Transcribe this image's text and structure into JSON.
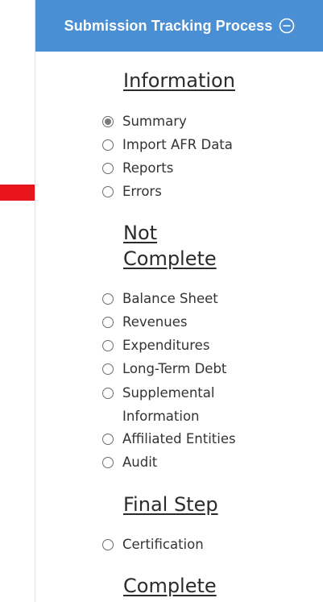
{
  "header": {
    "title": "Submission Tracking Process",
    "icon": "collapse-circle-minus-icon"
  },
  "sections": {
    "information": {
      "heading": "Information",
      "items": [
        {
          "label": "Summary",
          "checked": true
        },
        {
          "label": "Import AFR Data",
          "checked": false
        },
        {
          "label": "Reports",
          "checked": false
        },
        {
          "label": "Errors",
          "checked": false
        }
      ]
    },
    "not_complete": {
      "heading_line1": "Not",
      "heading_line2": "Complete",
      "items": [
        {
          "label": "Balance Sheet",
          "checked": false
        },
        {
          "label": "Revenues",
          "checked": false
        },
        {
          "label": "Expenditures",
          "checked": false
        },
        {
          "label": "Long-Term Debt",
          "checked": false
        },
        {
          "label": "Supplemental Information",
          "checked": false
        },
        {
          "label": "Affiliated Entities",
          "checked": false
        },
        {
          "label": "Audit",
          "checked": false
        }
      ]
    },
    "final_step": {
      "heading": "Final Step",
      "items": [
        {
          "label": "Certification",
          "checked": false
        }
      ]
    },
    "complete": {
      "heading": "Complete"
    }
  },
  "annotation": {
    "icon": "red-arrow-icon",
    "color": "#e8141b"
  },
  "colors": {
    "header_bg": "#4a8fd4",
    "header_text": "#ffffff"
  }
}
